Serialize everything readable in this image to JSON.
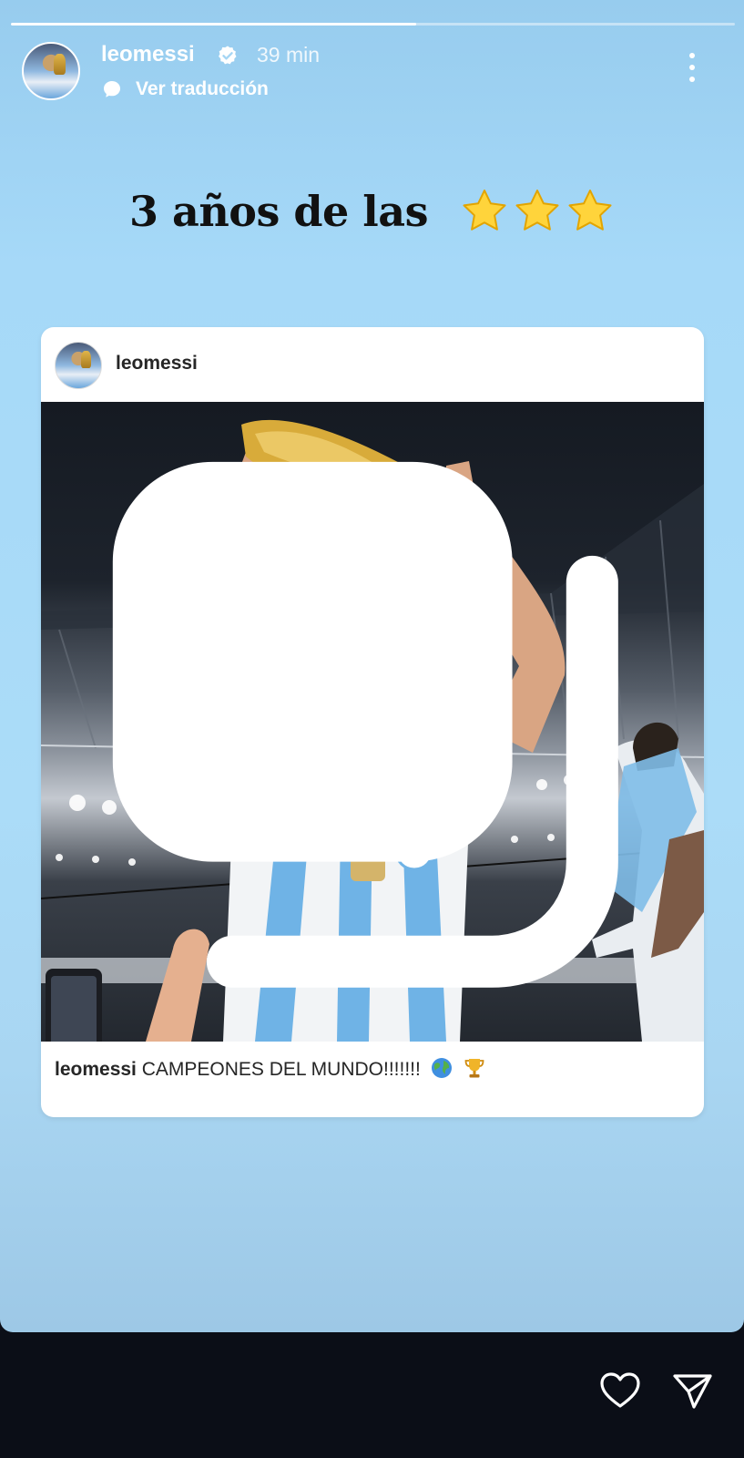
{
  "story": {
    "progress_fraction": 0.56
  },
  "header": {
    "username": "leomessi",
    "timestamp": "39 min",
    "translate_label": "Ver traducción",
    "verified_icon": "verified-badge-icon",
    "more_icon": "more-options-icon"
  },
  "headline": {
    "text": "3 años de las",
    "stars_icon": "star-icon",
    "star_count": 3
  },
  "shared_post": {
    "username": "leomessi",
    "caption_user": "leomessi",
    "caption_text": "CAMPEONES DEL MUNDO!!!!!!!",
    "caption_icons": [
      "globe-icon",
      "trophy-icon"
    ],
    "carousel_icon": "carousel-icon"
  },
  "footer": {
    "like_icon": "heart-icon",
    "send_icon": "send-icon"
  },
  "colors": {
    "background_top": "#97ccee",
    "background_mid": "#abdcf8",
    "bottom_bar": "#0b0e17",
    "jersey_blue": "#6fb3e6",
    "trophy_gold": "#d8ab3a"
  }
}
